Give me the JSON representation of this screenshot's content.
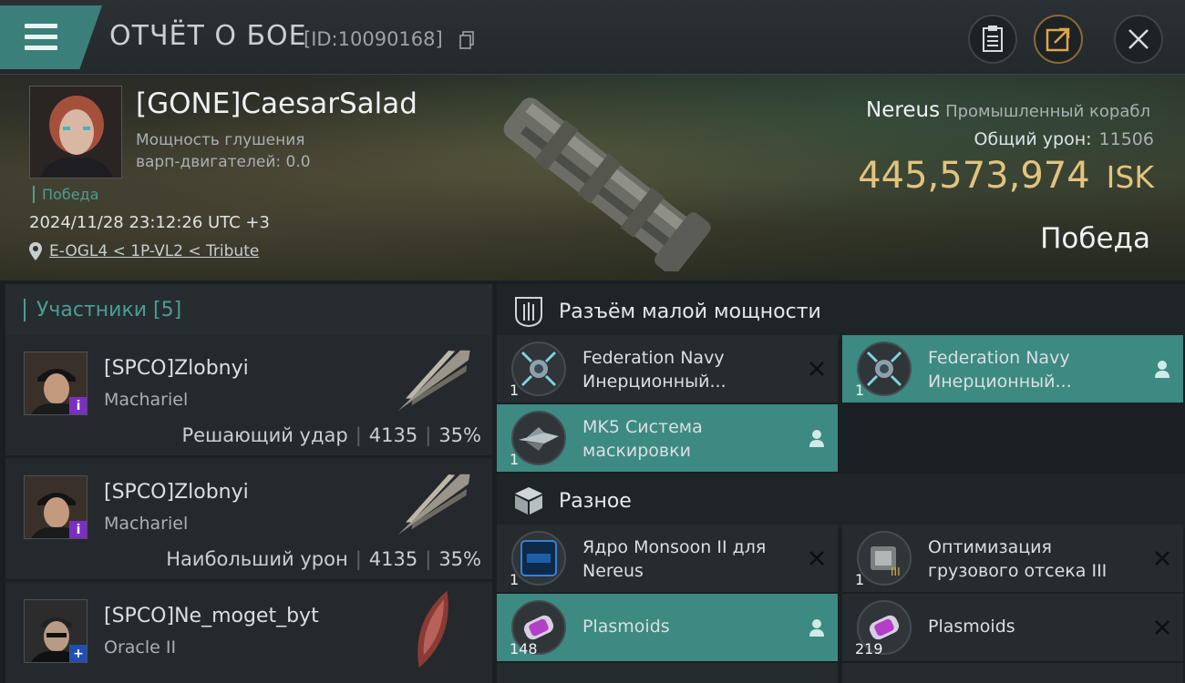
{
  "header": {
    "title": "ОТЧЁТ О БОЕ",
    "id_label": "[ID:10090168]",
    "icons": [
      "menu-icon",
      "copy-icon",
      "clipboard-icon",
      "share-icon",
      "close-icon"
    ]
  },
  "victim": {
    "name": "[GONE]CaesarSalad",
    "warp_scramble_line1": "Мощность глушения",
    "warp_scramble_line2": "варп-двигателей: 0.0",
    "tag": "Победа",
    "datetime": "2024/11/28 23:12:26 UTC +3",
    "location": "E-OGL4 < 1P-VL2 < Tribute",
    "ship_name": "Nereus",
    "ship_class": "Промышленный корабл",
    "total_damage_label": "Общий урон:",
    "total_damage_value": "11506",
    "isk_value": "445,573,974",
    "isk_unit": "ISK",
    "result": "Победа"
  },
  "participants": {
    "label": "Участники [5]",
    "rows": [
      {
        "name": "[SPCO]Zlobnyi",
        "ship": "Machariel",
        "role": "Решающий удар",
        "damage": "4135",
        "percent": "35%",
        "badge": "i",
        "badge_color": "#7a2fc2"
      },
      {
        "name": "[SPCO]Zlobnyi",
        "ship": "Machariel",
        "role": "Наибольший урон",
        "damage": "4135",
        "percent": "35%",
        "badge": "i",
        "badge_color": "#7a2fc2"
      },
      {
        "name": "[SPCO]Ne_moget_byt",
        "ship": "Oracle II",
        "role": "",
        "damage": "",
        "percent": "",
        "badge": "+",
        "badge_color": "#1f4fb0"
      }
    ]
  },
  "sections": {
    "low_slots": {
      "label": "Разъём малой мощности",
      "items": [
        {
          "line1": "Federation Navy",
          "line2": "Инерционный...",
          "qty": "1",
          "status": "destroyed",
          "selected": false
        },
        {
          "line1": "Federation Navy",
          "line2": "Инерционный...",
          "qty": "1",
          "status": "dropped",
          "selected": true
        },
        {
          "line1": "MK5 Система",
          "line2": "маскировки",
          "qty": "1",
          "status": "dropped",
          "selected": true
        }
      ]
    },
    "misc": {
      "label": "Разное",
      "items": [
        {
          "line1": "Ядро Monsoon II для",
          "line2": "Nereus",
          "qty": "1",
          "status": "destroyed",
          "selected": false
        },
        {
          "line1": "Оптимизация",
          "line2": "грузового отсека III",
          "qty": "1",
          "status": "destroyed",
          "selected": false
        },
        {
          "line1": "Plasmoids",
          "line2": "",
          "qty": "148",
          "status": "dropped",
          "selected": true
        },
        {
          "line1": "Plasmoids",
          "line2": "",
          "qty": "219",
          "status": "destroyed",
          "selected": false
        }
      ]
    }
  },
  "colors": {
    "accent": "#3d8a82",
    "isk": "#e3c47c",
    "victory": "#4d9c94"
  }
}
